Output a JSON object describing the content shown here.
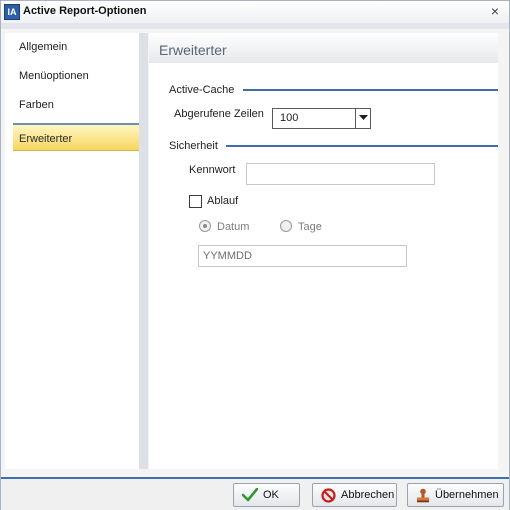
{
  "window": {
    "title": "Active Report-Optionen",
    "icon_name": "report-app-icon",
    "close_glyph": "×"
  },
  "sidebar": {
    "items": [
      {
        "label": "Allgemein",
        "active": false
      },
      {
        "label": "Menüoptionen",
        "active": false
      },
      {
        "label": "Farben",
        "active": false
      },
      {
        "label": "Erweiterter",
        "active": true
      }
    ]
  },
  "content": {
    "header": "Erweiterter",
    "active_cache": {
      "section_label": "Active-Cache",
      "rows_label": "Abgerufene Zeilen",
      "rows_value": "100"
    },
    "security": {
      "section_label": "Sicherheit",
      "password_label": "Kennwort",
      "password_value": "",
      "expiry_label": "Ablauf",
      "expiry_checked": false,
      "date_option": "Datum",
      "days_option": "Tage",
      "selected_option": "Datum",
      "date_placeholder": "YYMMDD"
    }
  },
  "footer": {
    "ok_label": "OK",
    "cancel_label": "Abbrechen",
    "apply_label": "Übernehmen"
  },
  "colors": {
    "accent": "#3f6faa",
    "active_item": "#f7d660",
    "ok_check": "#2e9b2e",
    "cancel_red": "#c81e1e"
  }
}
